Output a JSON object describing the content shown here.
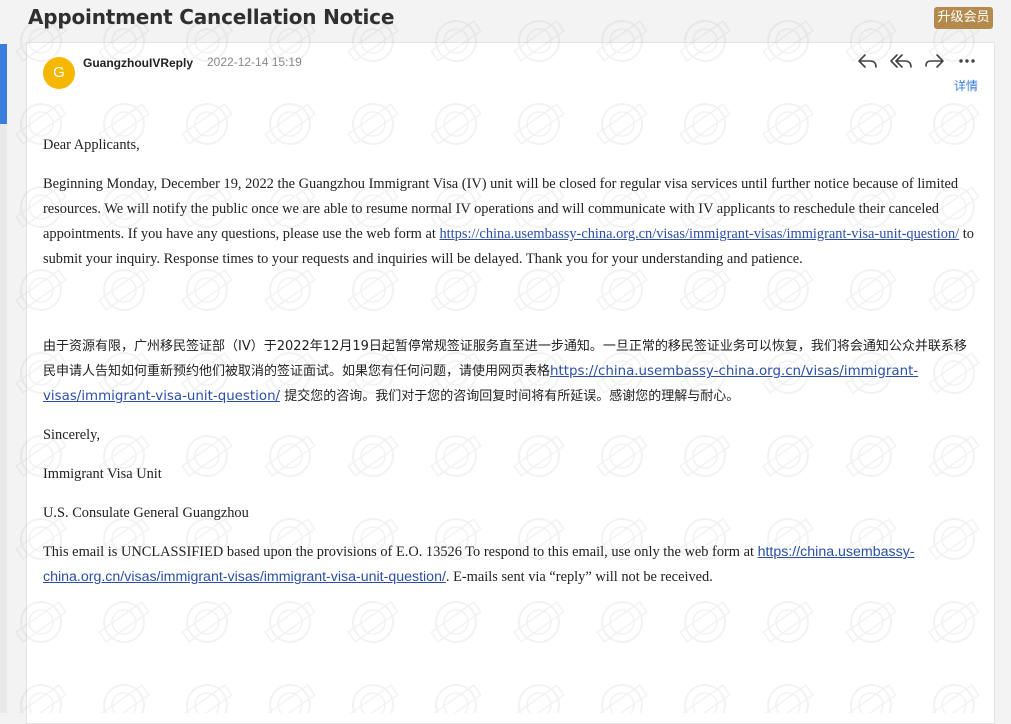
{
  "email": {
    "subject": "Appointment Cancellation Notice",
    "upgrade_label": "升级会员",
    "sender_initial": "G",
    "sender_name": "GuangzhouIVReply",
    "date": "2022-12-14 15:19",
    "details_label": "详情",
    "actions": [
      "reply-icon",
      "reply-all-icon",
      "forward-icon",
      "more-icon"
    ],
    "greeting": "Dear Applicants,",
    "paragraph1_before_link": "Beginning Monday, December 19, 2022 the Guangzhou Immigrant Visa (IV) unit will be closed for regular visa services until further notice because of limited resources.  We will notify the public once we are able to resume normal IV operations and will communicate with IV applicants to reschedule their canceled appointments.  If you have any questions, please use the web form at ",
    "paragraph1_link": "https://china.usembassy-china.org.cn/visas/immigrant-visas/immigrant-visa-unit-question/",
    "paragraph1_after_link": " to submit your inquiry.  Response times to your requests and inquiries will be delayed.  Thank you for your understanding and patience.",
    "chinese_before_link": "由于资源有限，广州移民签证部（IV）于2022年12月19日起暂停常规签证服务直至进一步通知。一旦正常的移民签证业务可以恢复，我们将会通知公众并联系移民申请人告知如何重新预约他们被取消的签证面试。如果您有任何问题，请使用网页表格",
    "chinese_link": "https://china.usembassy-china.org.cn/visas/immigrant-visas/immigrant-visa-unit-question/",
    "chinese_after_link": " 提交您的咨询。我们对于您的咨询回复时间将有所延误。感谢您的理解与耐心。",
    "closing": "Sincerely,",
    "signature1": "Immigrant Visa Unit",
    "signature2": "U.S. Consulate General Guangzhou",
    "footer_before_link": "This email is UNCLASSIFIED based upon the provisions of E.O. 13526 To respond to this email, use only the web form at ",
    "footer_link": "https://china.usembassy-china.org.cn/visas/immigrant-visas/immigrant-visa-unit-question/",
    "footer_after_link": ". E-mails sent via “reply” will not be received."
  },
  "colors": {
    "accent": "#3b7ddd",
    "avatar": "#f5b700",
    "upgrade_badge": "#b58a4d",
    "link": "#2b4fa6"
  }
}
